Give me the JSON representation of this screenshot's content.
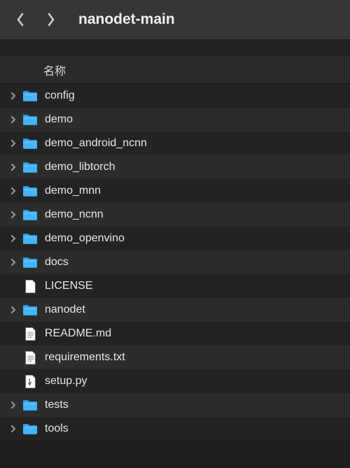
{
  "toolbar": {
    "title": "nanodet-main"
  },
  "columns": {
    "name": "名称"
  },
  "items": [
    {
      "name": "config",
      "type": "folder",
      "expandable": true
    },
    {
      "name": "demo",
      "type": "folder",
      "expandable": true
    },
    {
      "name": "demo_android_ncnn",
      "type": "folder",
      "expandable": true
    },
    {
      "name": "demo_libtorch",
      "type": "folder",
      "expandable": true
    },
    {
      "name": "demo_mnn",
      "type": "folder",
      "expandable": true
    },
    {
      "name": "demo_ncnn",
      "type": "folder",
      "expandable": true
    },
    {
      "name": "demo_openvino",
      "type": "folder",
      "expandable": true
    },
    {
      "name": "docs",
      "type": "folder",
      "expandable": true
    },
    {
      "name": "LICENSE",
      "type": "file-blank",
      "expandable": false
    },
    {
      "name": "nanodet",
      "type": "folder",
      "expandable": true
    },
    {
      "name": "README.md",
      "type": "file-text",
      "expandable": false
    },
    {
      "name": "requirements.txt",
      "type": "file-text",
      "expandable": false
    },
    {
      "name": "setup.py",
      "type": "file-py",
      "expandable": false
    },
    {
      "name": "tests",
      "type": "folder",
      "expandable": true
    },
    {
      "name": "tools",
      "type": "folder",
      "expandable": true
    }
  ]
}
